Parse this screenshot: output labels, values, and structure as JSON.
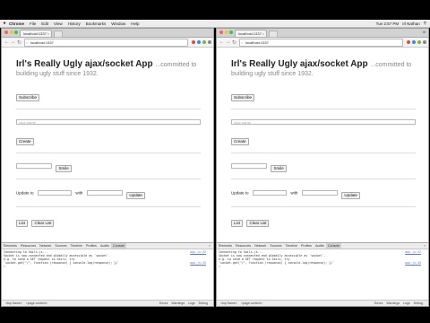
{
  "menubar": {
    "apple": "",
    "items": [
      "Chrome",
      "File",
      "Edit",
      "View",
      "History",
      "Bookmarks",
      "Window",
      "Help"
    ],
    "right_time": "Tue 2:57 PM",
    "right_user": "Irl Nathan"
  },
  "windows": [
    {
      "tab_title": "localhost:1337",
      "url": "localhost:1337",
      "profile": "",
      "page": {
        "title": "Irl's Really Ugly ajax/socket App",
        "tagline": "...committed to",
        "tagline2": "building ugly stuff since 1932.",
        "subscribe": "Subscribe",
        "name_placeholder": "your name",
        "create": "Create",
        "smile": "Smile",
        "update_to": "Update to",
        "with": "with",
        "update": "Update",
        "list": "List",
        "clear_list": "Clear List"
      },
      "devtools": {
        "tabs": [
          "Elements",
          "Resources",
          "Network",
          "Sources",
          "Timeline",
          "Profiles",
          "Audits",
          "Console"
        ],
        "console": [
          {
            "text": "Connecting to Sails.js...",
            "src": "app.js:42"
          },
          {
            "text": "Socket is now connected and globally accessible as `socket`.",
            "src": ""
          },
          {
            "text": "e.g. to send a GET request to Sails, try",
            "src": ""
          },
          {
            "text": "`socket.get(\"/\", function (response) { console.log(response); })`",
            "src": "app.js:45"
          }
        ],
        "prompt": ">",
        "status": [
          "<top frame>",
          "<page context>",
          "Errors",
          "Warnings",
          "Logs",
          "Debug"
        ]
      }
    },
    {
      "tab_title": "localhost:1337",
      "url": "localhost:1337",
      "profile": "Irl",
      "page": {
        "title": "Irl's Really Ugly ajax/socket App",
        "tagline": "...committed to",
        "tagline2": "building ugly stuff since 1932.",
        "subscribe": "Subscribe",
        "name_placeholder": "your name",
        "create": "Create",
        "smile": "Smile",
        "update_to": "Update to",
        "with": "with",
        "update": "Update",
        "list": "List",
        "clear_list": "Clear List"
      },
      "devtools": {
        "tabs": [
          "Elements",
          "Resources",
          "Network",
          "Sources",
          "Timeline",
          "Profiles",
          "Audits",
          "Console"
        ],
        "console": [
          {
            "text": "Connecting to Sails.js...",
            "src": "app.js:42"
          },
          {
            "text": "Socket is now connected and globally accessible as `socket`.",
            "src": ""
          },
          {
            "text": "e.g. to send a GET request to Sails, try",
            "src": ""
          },
          {
            "text": "`socket.get(\"/\", function (response) { console.log(response); })`",
            "src": "app.js:45"
          }
        ],
        "prompt": ">",
        "status": [
          "<top frame>",
          "<page context>",
          "Errors",
          "Warnings",
          "Logs",
          "Debug"
        ]
      }
    }
  ],
  "colors": {
    "traffic_red": "#fc605b",
    "traffic_yellow": "#fdbc40",
    "traffic_green": "#34c84a",
    "console_link": "#5a7dbf"
  }
}
